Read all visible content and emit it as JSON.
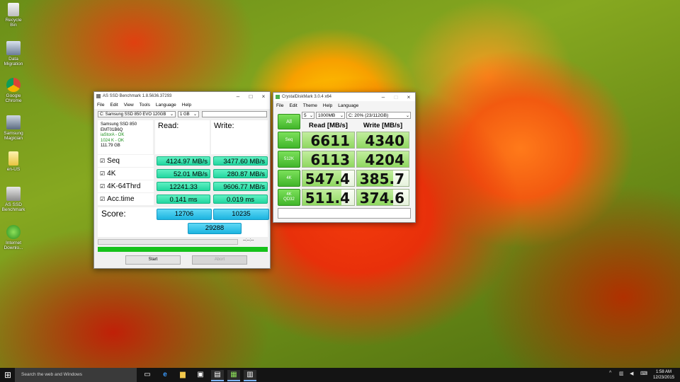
{
  "desktop": {
    "icons": [
      {
        "label": "Recycle Bin",
        "icon": "recycle-bin-icon"
      },
      {
        "label": "Data Migration",
        "icon": "data-migration-icon"
      },
      {
        "label": "Google Chrome",
        "icon": "chrome-icon"
      },
      {
        "label": "Samsung Magician",
        "icon": "magician-icon"
      },
      {
        "label": "en-US",
        "icon": "document-icon"
      },
      {
        "label": "AS SSD Benchmark",
        "icon": "benchmark-icon"
      },
      {
        "label": "Internet Downlo...",
        "icon": "idm-icon"
      }
    ]
  },
  "asssd": {
    "title": "AS SSD Benchmark 1.8.5636.37293",
    "menu": [
      "File",
      "Edit",
      "View",
      "Tools",
      "Language",
      "Help"
    ],
    "drive_select": "C: Samsung SSD 850 EVO 120GB",
    "size_select": "1 GB",
    "info": {
      "model": "Samsung SSD 850",
      "firmware": "EMT01B6Q",
      "driver": "iaStorA - OK",
      "alignment": "1024 K - OK",
      "capacity": "111.79 GB"
    },
    "read_label": "Read:",
    "write_label": "Write:",
    "rows": [
      {
        "check": "☑",
        "label": "Seq",
        "read": "4124.97 MB/s",
        "write": "3477.60 MB/s"
      },
      {
        "check": "☑",
        "label": "4K",
        "read": "52.01 MB/s",
        "write": "280.87 MB/s"
      },
      {
        "check": "☑",
        "label": "4K-64Thrd",
        "read": "12241.33",
        "write": "9606.77 MB/s"
      },
      {
        "check": "☑",
        "label": "Acc.time",
        "read": "0.141 ms",
        "write": "0.019 ms"
      }
    ],
    "score_label": "Score:",
    "score_read": "12706",
    "score_write": "10235",
    "score_total": "29288",
    "progress_time": "--:--:--",
    "start_label": "Start",
    "abort_label": "Abort"
  },
  "cdm": {
    "title": "CrystalDiskMark 3.0.4 x64",
    "menu": [
      "File",
      "Edit",
      "Theme",
      "Help",
      "Language"
    ],
    "count_select": "5",
    "size_select": "1000MB",
    "drive_select": "C: 20% (23/112GB)",
    "all_label": "All",
    "read_header": "Read [MB/s]",
    "write_header": "Write [MB/s]",
    "rows": [
      {
        "label": "Seq",
        "read": "6611",
        "write": "4340",
        "read_fill": 1.0,
        "write_fill": 1.0
      },
      {
        "label": "512K",
        "read": "6113",
        "write": "4204",
        "read_fill": 1.0,
        "write_fill": 1.0
      },
      {
        "label": "4K",
        "read": "547.4",
        "write": "385.7",
        "read_fill": 0.75,
        "write_fill": 0.7
      },
      {
        "label": "4K QD32",
        "read": "511.4",
        "write": "374.6",
        "read_fill": 0.75,
        "write_fill": 0.7
      }
    ]
  },
  "taskbar": {
    "search_placeholder": "Search the web and Windows",
    "time": "1:58 AM",
    "date": "12/23/2015"
  }
}
